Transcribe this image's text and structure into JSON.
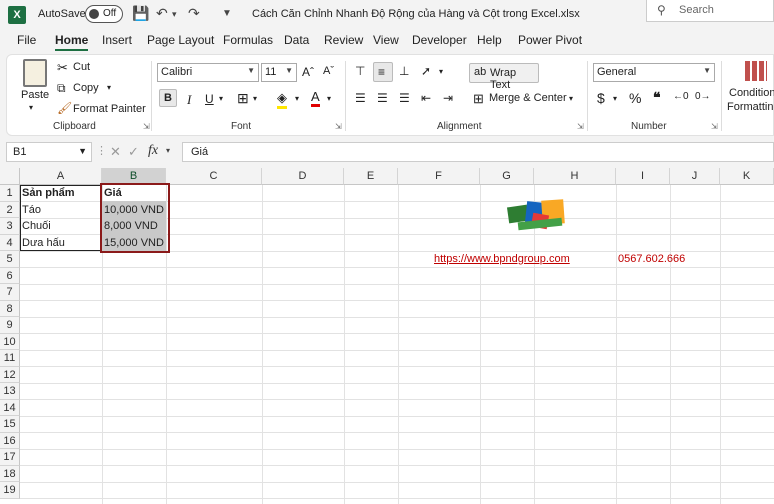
{
  "app": {
    "autosave_label": "AutoSave",
    "autosave_state": "Off",
    "title": "Cách Căn Chỉnh Nhanh Độ Rộng của Hàng và Cột trong Excel.xlsx",
    "search_placeholder": "Search"
  },
  "menu": [
    "File",
    "Home",
    "Insert",
    "Page Layout",
    "Formulas",
    "Data",
    "Review",
    "View",
    "Developer",
    "Help",
    "Power Pivot"
  ],
  "ribbon": {
    "clipboard": {
      "paste": "Paste",
      "cut": "Cut",
      "copy": "Copy",
      "format_painter": "Format Painter",
      "label": "Clipboard"
    },
    "font": {
      "name": "Calibri",
      "size": "11",
      "label": "Font",
      "bold": "B",
      "italic": "I",
      "underline": "U"
    },
    "alignment": {
      "wrap_text": "Wrap Text",
      "merge_center": "Merge & Center",
      "label": "Alignment"
    },
    "number": {
      "format": "General",
      "label": "Number"
    },
    "styles": {
      "conditional": "Condition",
      "formatting": "Formatting"
    }
  },
  "formula_bar": {
    "cell_ref": "B1",
    "formula": "Giá"
  },
  "sheet": {
    "columns": [
      "A",
      "B",
      "C",
      "D",
      "E",
      "F",
      "G",
      "H",
      "I",
      "J",
      "K"
    ],
    "rows": [
      "1",
      "2",
      "3",
      "4",
      "5",
      "6",
      "7",
      "8",
      "9",
      "10",
      "11",
      "12",
      "13",
      "14",
      "15",
      "16",
      "17",
      "18",
      "19"
    ],
    "cells": {
      "A1": "Sản phẩm",
      "B1": "Giá",
      "A2": "Táo",
      "B2": "10,000 VND",
      "A3": "Chuối",
      "B3": "8,000 VND",
      "A4": "Dưa hấu",
      "B4": "15,000 VND",
      "F5": "https://www.bpndgroup.com",
      "I5": "0567.602.666"
    },
    "colors": {
      "link": "#c00000",
      "selection": "#8b1a1a",
      "accent": "#1d6f42"
    }
  }
}
